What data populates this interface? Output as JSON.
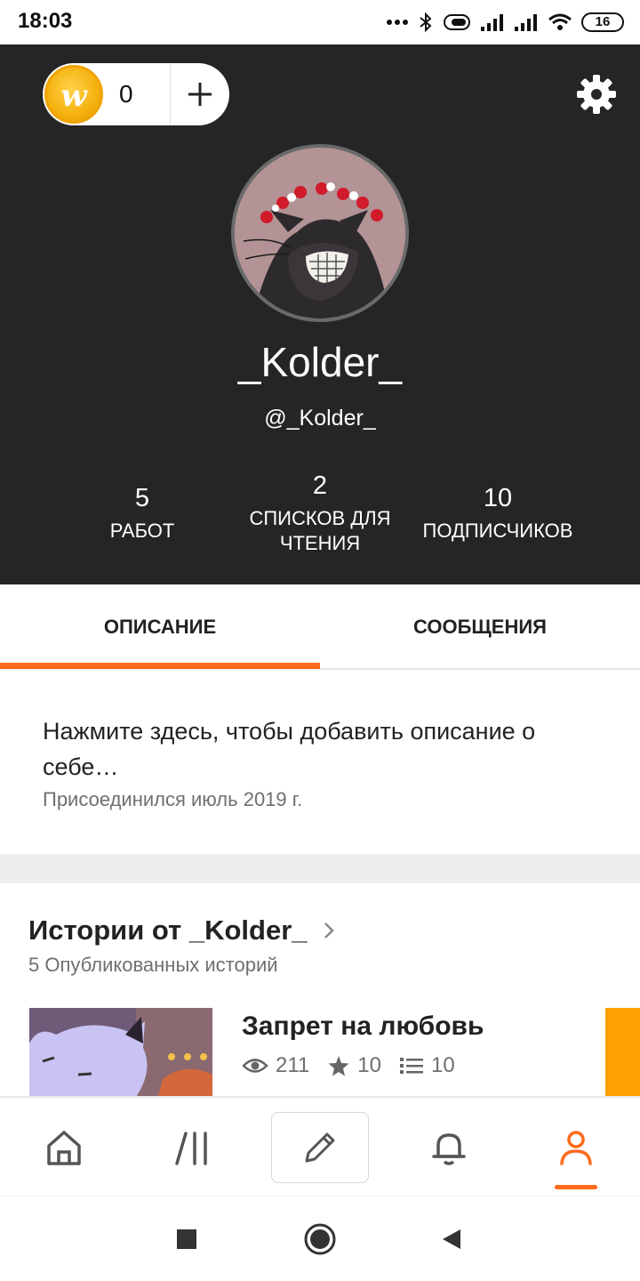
{
  "status_bar": {
    "time": "18:03",
    "battery": "16"
  },
  "coins": {
    "count": "0",
    "icon": "wattpad-coin-icon",
    "add_icon": "plus-icon"
  },
  "profile": {
    "display_name": "_Kolder_",
    "handle": "@_Kolder_",
    "stats": [
      {
        "value": "5",
        "label": "РАБОТ"
      },
      {
        "value": "2",
        "label": "СПИСКОВ ДЛЯ ЧТЕНИЯ"
      },
      {
        "value": "10",
        "label": "ПОДПИСЧИКОВ"
      }
    ]
  },
  "tabs": [
    {
      "label": "ОПИСАНИЕ",
      "active": true
    },
    {
      "label": "СООБЩЕНИЯ",
      "active": false
    }
  ],
  "about": {
    "prompt": "Нажмите здесь, чтобы добавить описание о себе…",
    "joined": "Присоединился июль 2019 г."
  },
  "stories": {
    "title": "Истории от _Kolder_",
    "subtitle": "5 Опубликованных историй",
    "items": [
      {
        "title": "Запрет на любовь",
        "views": "211",
        "votes": "10",
        "parts": "10"
      }
    ]
  },
  "colors": {
    "accent": "#ff6a1a",
    "header_bg": "#262526",
    "coin": "#f5b10e",
    "story_tab": "#ff9f00"
  },
  "bottom_nav": [
    "home-icon",
    "library-icon",
    "write-pencil-icon",
    "notifications-bell-icon",
    "profile-icon"
  ],
  "system_nav": [
    "recent-apps-icon",
    "home-circle-icon",
    "back-icon"
  ]
}
